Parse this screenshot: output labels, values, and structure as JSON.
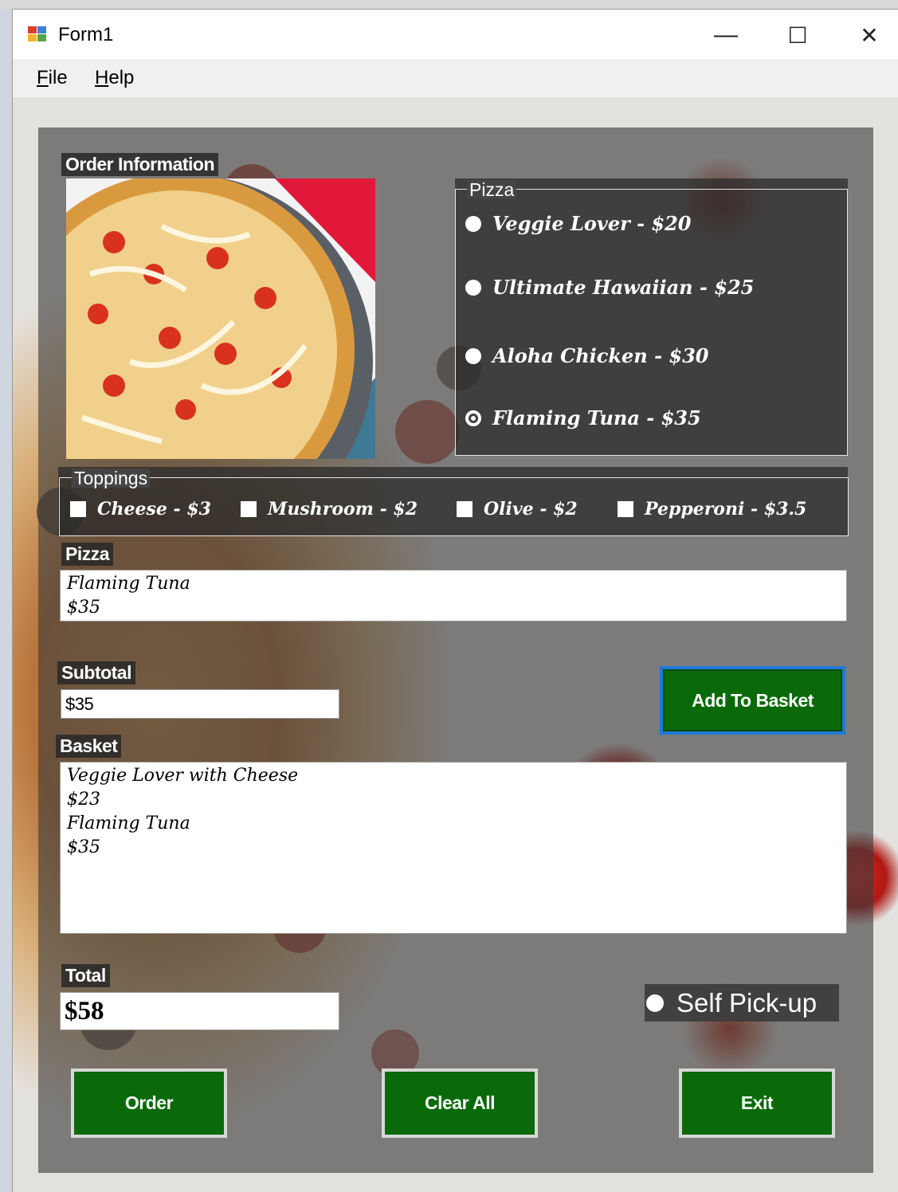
{
  "window": {
    "title": "Form1",
    "minimize": "—",
    "maximize": "☐",
    "close": "✕"
  },
  "menu": {
    "file_hotkey": "F",
    "file_rest": "ile",
    "help_hotkey": "H",
    "help_rest": "elp"
  },
  "order_info": {
    "label": "Order Information"
  },
  "pizza_group": {
    "label": "Pizza",
    "options": [
      {
        "label": "Veggie Lover - $20",
        "selected": false
      },
      {
        "label": "Ultimate Hawaiian - $25",
        "selected": false
      },
      {
        "label": "Aloha Chicken - $30",
        "selected": false
      },
      {
        "label": "Flaming Tuna - $35",
        "selected": true
      }
    ]
  },
  "toppings_group": {
    "label": "Toppings",
    "options": [
      {
        "label": "Cheese - $3",
        "checked": false
      },
      {
        "label": "Mushroom - $2",
        "checked": false
      },
      {
        "label": "Olive - $2",
        "checked": false
      },
      {
        "label": "Pepperoni - $3.5",
        "checked": false
      }
    ]
  },
  "pizza_field": {
    "label": "Pizza",
    "lines": [
      "Flaming Tuna",
      "$35"
    ]
  },
  "subtotal": {
    "label": "Subtotal",
    "value": "$35"
  },
  "add_to_basket": {
    "label": "Add To Basket"
  },
  "basket": {
    "label": "Basket",
    "lines": [
      "Veggie Lover with Cheese",
      "$23",
      "Flaming Tuna",
      "$35"
    ]
  },
  "total": {
    "label": "Total",
    "value": "$58"
  },
  "self_pickup": {
    "label": "Self Pick-up",
    "selected": false
  },
  "buttons": {
    "order": "Order",
    "clear_all": "Clear All",
    "exit": "Exit"
  },
  "colors": {
    "button_green": "#0a6a0a",
    "panel_overlay": "#3c3c3c",
    "focus_blue": "#1e7ad6"
  },
  "icons": {
    "app": "form-app-icon",
    "minimize": "minimize-icon",
    "maximize": "maximize-icon",
    "close": "close-icon",
    "radio": "radio-button-icon",
    "checkbox": "checkbox-icon"
  }
}
